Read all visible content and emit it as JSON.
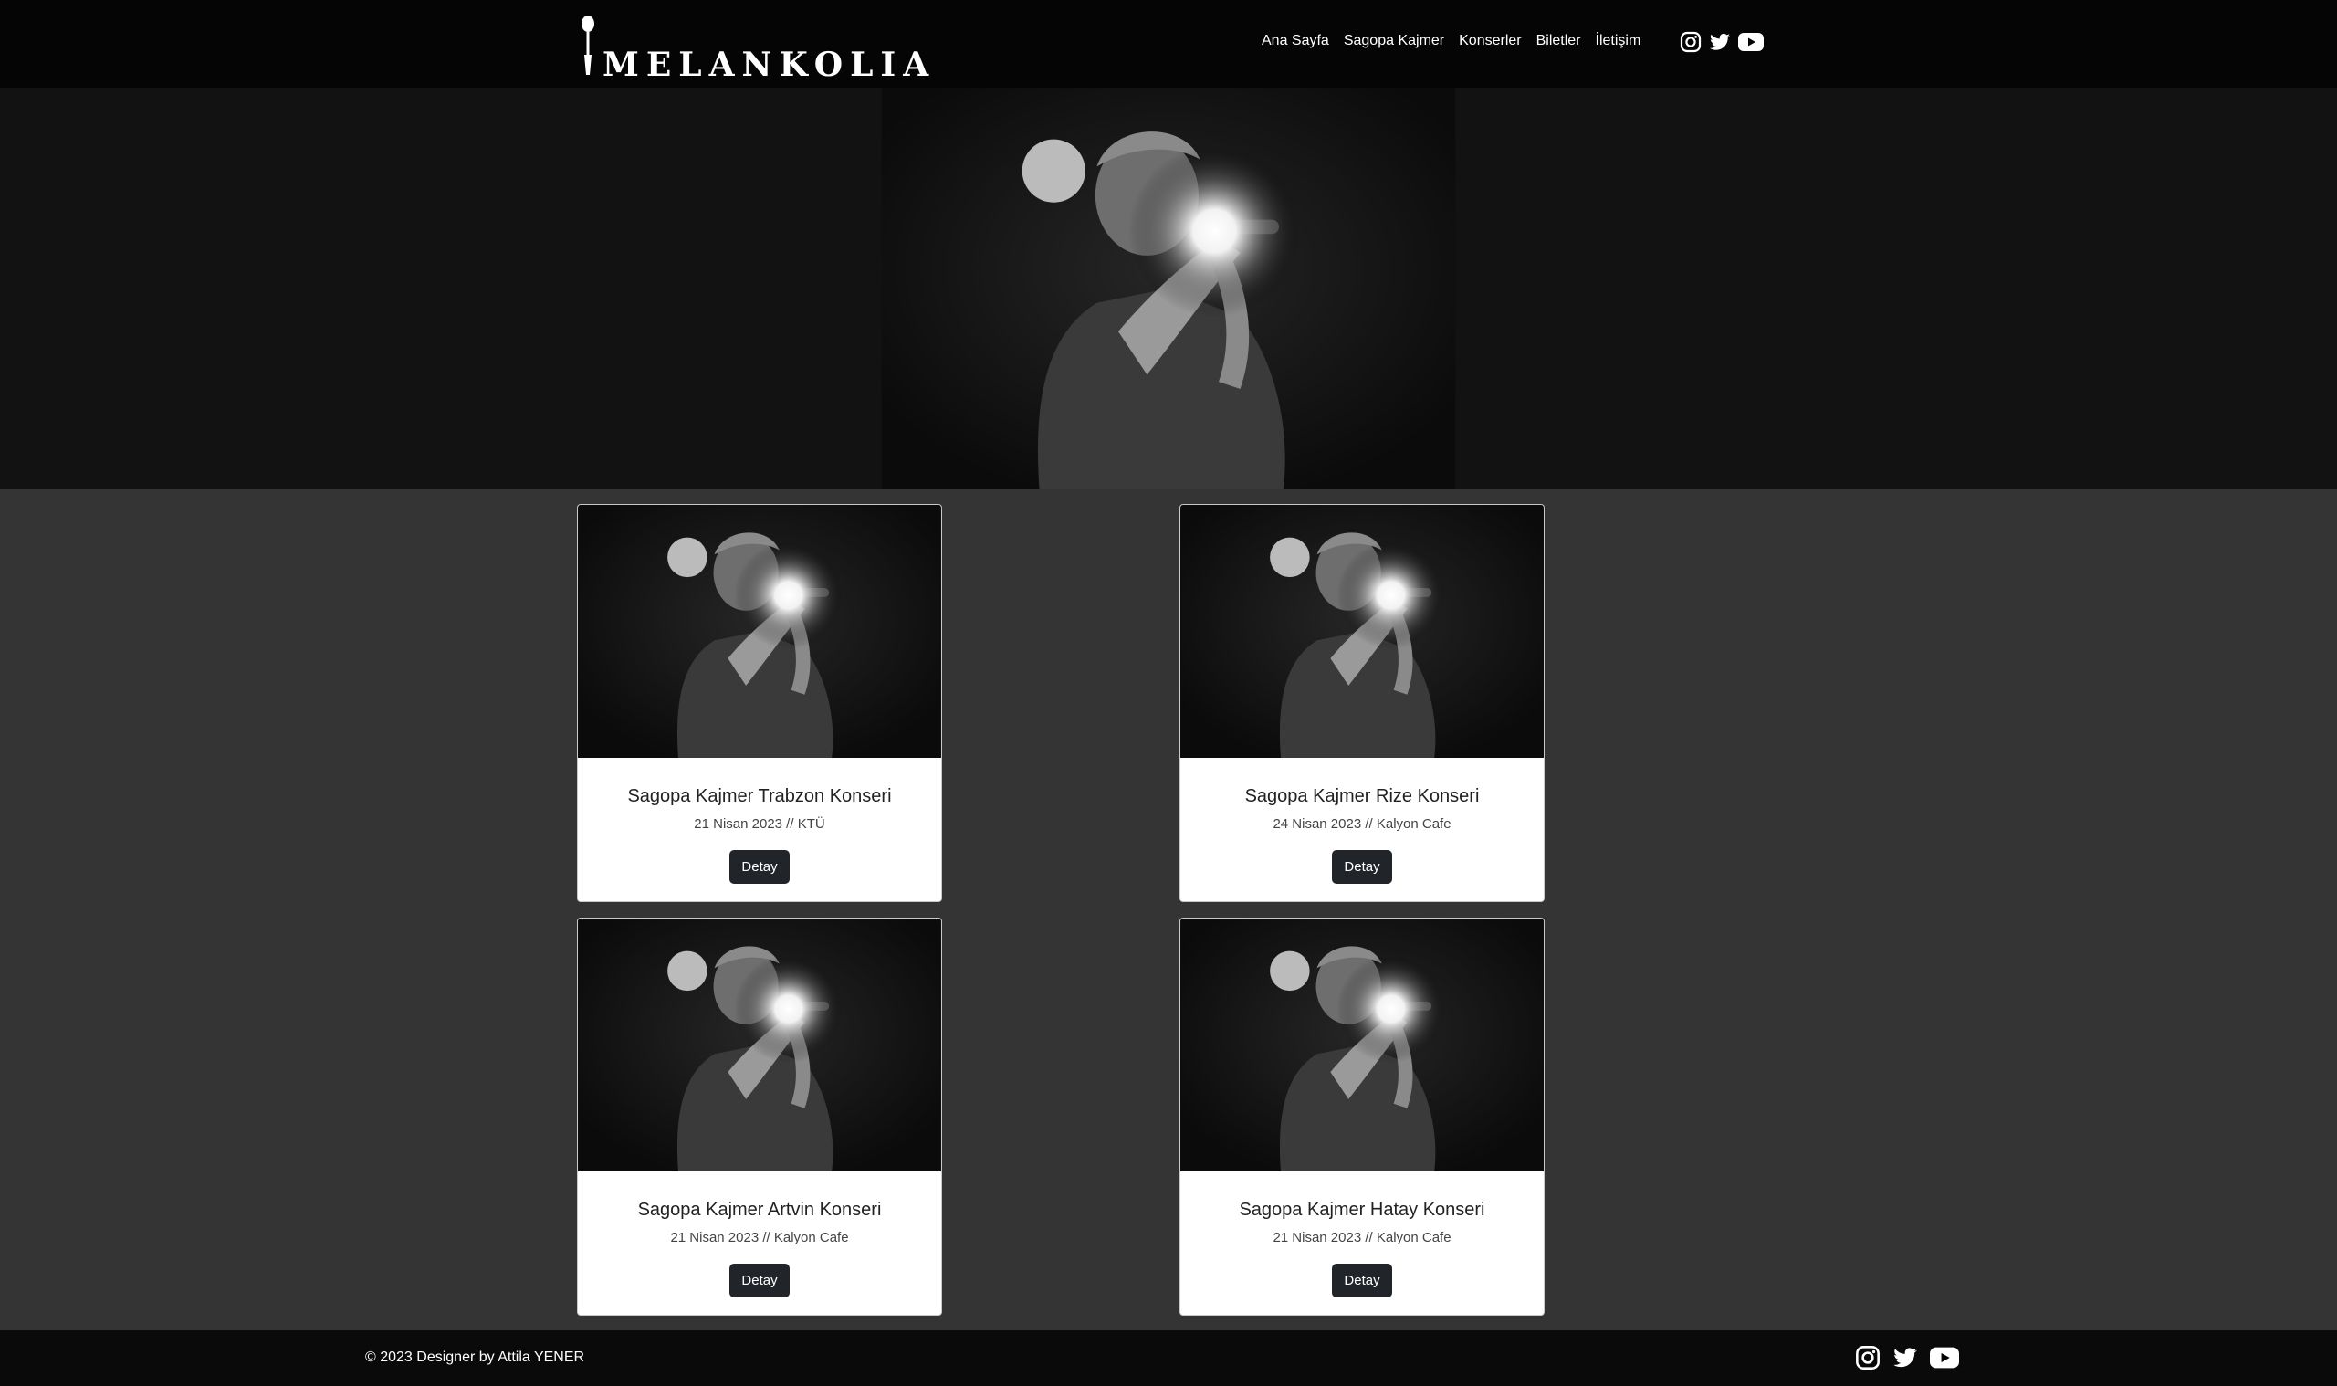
{
  "header": {
    "logo_text": "MELANKOLIA",
    "nav": [
      {
        "label": "Ana Sayfa"
      },
      {
        "label": "Sagopa Kajmer"
      },
      {
        "label": "Konserler"
      },
      {
        "label": "Biletler"
      },
      {
        "label": "İletişim"
      }
    ],
    "social_icons": [
      "instagram-icon",
      "twitter-icon",
      "youtube-icon"
    ]
  },
  "hero": {
    "image": "concert-singer-photo"
  },
  "concerts": [
    {
      "title": "Sagopa Kajmer Trabzon Konseri",
      "subtitle": "21 Nisan 2023 // KTÜ",
      "button": "Detay"
    },
    {
      "title": "Sagopa Kajmer Rize Konseri",
      "subtitle": "24 Nisan 2023 // Kalyon Cafe",
      "button": "Detay"
    },
    {
      "title": "Sagopa Kajmer Artvin Konseri",
      "subtitle": "21 Nisan 2023 // Kalyon Cafe",
      "button": "Detay"
    },
    {
      "title": "Sagopa Kajmer Hatay Konseri",
      "subtitle": "21 Nisan 2023 // Kalyon Cafe",
      "button": "Detay"
    }
  ],
  "footer": {
    "copyright": "© 2023 Designer by Attila YENER",
    "social_icons": [
      "instagram-icon",
      "twitter-icon",
      "youtube-icon"
    ]
  },
  "colors": {
    "navbar_bg": "#050505",
    "page_bg": "#343434",
    "button_bg": "#212529",
    "card_bg": "#ffffff"
  }
}
